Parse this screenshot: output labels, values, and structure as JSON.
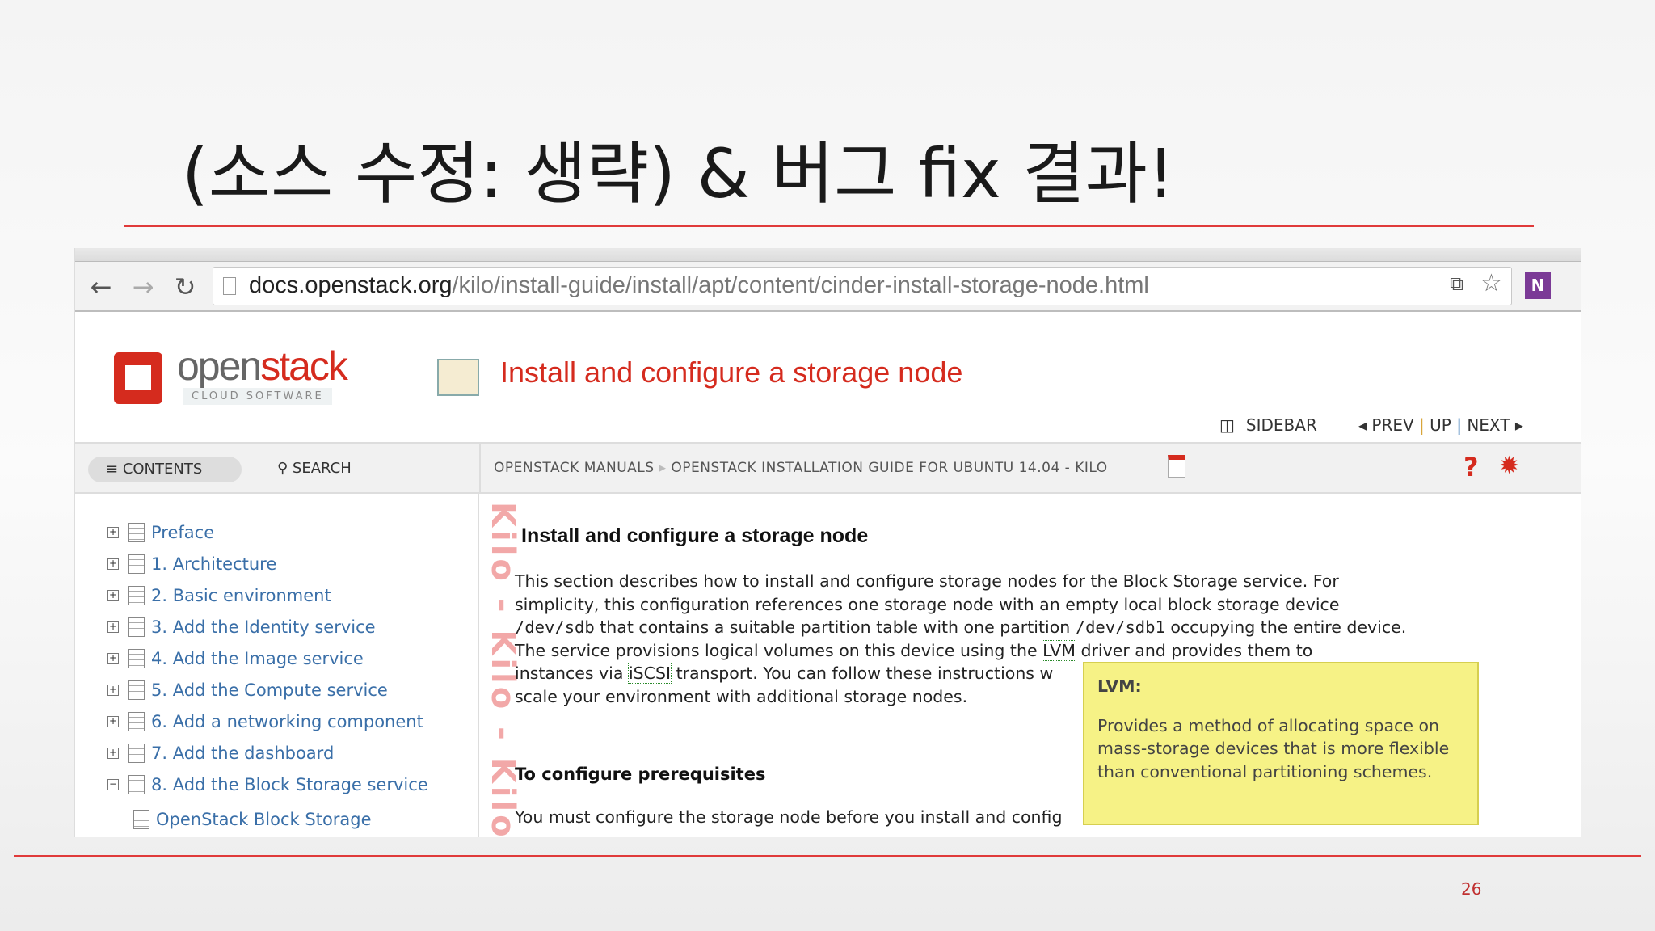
{
  "slide": {
    "title": "(소스 수정: 생략) & 버그 fix 결과!",
    "page_number": "26",
    "accent": "#e03a3a"
  },
  "browser": {
    "url_host": "docs.openstack.org",
    "url_path": "/kilo/install-guide/install/apt/content/cinder-install-storage-node.html"
  },
  "header": {
    "logo_word_open": "open",
    "logo_word_stack": "stack",
    "logo_tagline": "CLOUD SOFTWARE",
    "page_title": "Install and configure a storage node",
    "sidebar_label": "SIDEBAR",
    "prev": "PREV",
    "up": "UP",
    "next": "NEXT"
  },
  "toolbar": {
    "contents": "CONTENTS",
    "search": "SEARCH",
    "breadcrumb_1": "OPENSTACK MANUALS",
    "breadcrumb_2": "OPENSTACK INSTALLATION GUIDE FOR UBUNTU 14.04  - KILO",
    "help": "?"
  },
  "toc": [
    {
      "label": "Preface"
    },
    {
      "label": "1. Architecture"
    },
    {
      "label": "2. Basic environment"
    },
    {
      "label": "3. Add the Identity service"
    },
    {
      "label": "4. Add the Image service"
    },
    {
      "label": "5. Add the Compute service"
    },
    {
      "label": "6. Add a networking component"
    },
    {
      "label": "7. Add the dashboard"
    },
    {
      "label": "8. Add the Block Storage service"
    },
    {
      "label": "OpenStack Block Storage"
    }
  ],
  "content": {
    "watermark": "Kilo - Kilo - Kilo",
    "heading": "Install and configure a storage node",
    "p1_l1": "This section describes how to install and configure storage nodes for the Block Storage service. For",
    "p1_l2": "simplicity, this configuration references one storage node with an empty local block storage device",
    "p1_l3a": "/dev/sdb",
    "p1_l3b": " that contains a suitable partition table with one partition ",
    "p1_l3c": "/dev/sdb1",
    "p1_l3d": " occupying the entire device.",
    "p1_l4a": "The service provisions logical volumes on this device using the ",
    "p1_l4b": "LVM",
    "p1_l4c": " driver and provides them to",
    "p1_l5a": "instances via ",
    "p1_l5b": "iSCSI",
    "p1_l5c": " transport. You can follow these instructions w",
    "p1_l6": "scale your environment with additional storage nodes.",
    "heading2": "To configure prerequisites",
    "p2_l1": "You must configure the storage node before you install and config"
  },
  "tooltip": {
    "term": "LVM:",
    "definition": "Provides a method of allocating space on mass-storage devices that is more flexible than conventional partitioning schemes."
  }
}
